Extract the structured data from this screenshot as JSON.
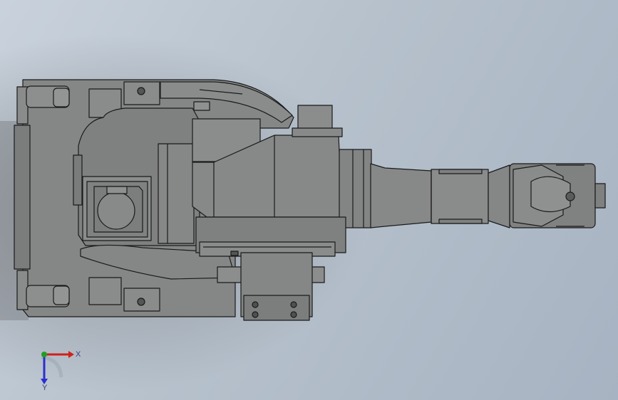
{
  "view": {
    "background_top": "#c9d2dc",
    "background_bottom": "#a7b3c2",
    "part_color": "#808282",
    "edge_color": "#1a1a1a"
  },
  "triad": {
    "x_label": "X",
    "y_label": "Y",
    "x_color": "#d0201c",
    "y_color": "#2a2fd0",
    "z_color": "#20a020"
  }
}
